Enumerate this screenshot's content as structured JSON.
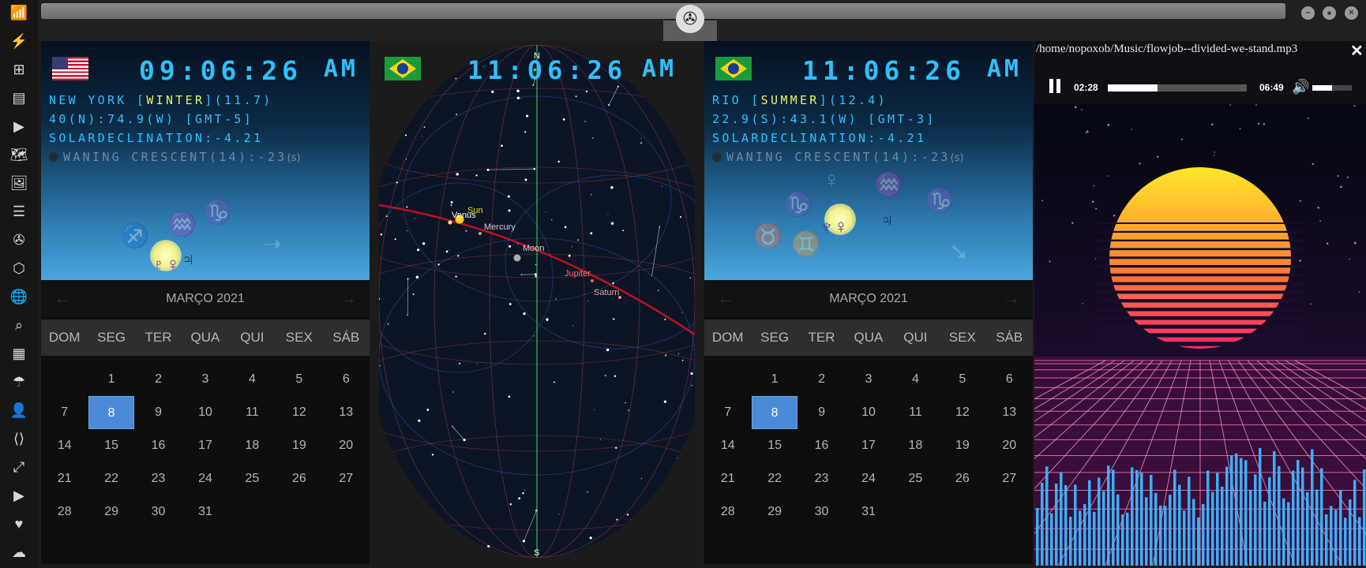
{
  "dock": {
    "icons": [
      "wifi-icon",
      "lightning-icon",
      "windows-icon",
      "inbox-icon",
      "play-icon",
      "map-icon",
      "image-icon",
      "news-icon",
      "rebel-icon",
      "hexagon-icon",
      "globe-icon",
      "search-icon",
      "world-map-icon",
      "umbrella-icon",
      "contacts-icon",
      "code-icon",
      "fullscreen-icon",
      "youtube-icon",
      "heart-icon",
      "cloud-icon"
    ],
    "glyphs": [
      "📶",
      "⚡",
      "⊞",
      "▤",
      "▶",
      "🗺",
      "🖼",
      "☰",
      "✇",
      "⬡",
      "🌐",
      "⌕",
      "▦",
      "☂",
      "👤",
      "⟨⟩",
      "⤢",
      "▶",
      "♥",
      "☁"
    ]
  },
  "window": {
    "minimize": "–",
    "maximize": "■",
    "close": "×",
    "logo": "✇"
  },
  "clocks": [
    {
      "flag": "us",
      "time": "09:06:26",
      "ampm": "AM",
      "city_pre": "NEW YORK [",
      "season": "WINTER",
      "city_post": "](11.7)",
      "coords": "40(N):74.9(W) [GMT-5]",
      "declination": "SOLARDECLINATION:-4.21",
      "moon_main": "WANING CRESCENT(14):-23",
      "moon_suffix": "(s)",
      "jupiter": "♃",
      "planets": "♇♀"
    },
    {
      "flag": "br",
      "time": "11:06:26",
      "ampm": "AM",
      "city_pre": "RIO [",
      "season": "SUMMER",
      "city_post": "](12.4)",
      "coords": "22.9(S):43.1(W) [GMT-3]",
      "declination": "SOLARDECLINATION:-4.21",
      "moon_main": "WANING CRESCENT(14):-23",
      "moon_suffix": "(s)",
      "jupiter": "♃",
      "planets": "♆♀"
    }
  ],
  "sky": {
    "time": "11:06:26",
    "ampm": "AM",
    "north": "N",
    "south": "S",
    "bodies": [
      "Sun",
      "Venus",
      "Mercury",
      "Moon",
      "Jupiter",
      "Saturn"
    ]
  },
  "calendars": [
    {
      "month": "MARÇO 2021",
      "prev": "←",
      "next": "→",
      "weekdays": [
        "DOM",
        "SEG",
        "TER",
        "QUA",
        "QUI",
        "SEX",
        "SÁB"
      ],
      "days": [
        "",
        "1",
        "2",
        "3",
        "4",
        "5",
        "6",
        "7",
        "8",
        "9",
        "10",
        "11",
        "12",
        "13",
        "14",
        "15",
        "16",
        "17",
        "18",
        "19",
        "20",
        "21",
        "22",
        "23",
        "24",
        "25",
        "26",
        "27",
        "28",
        "29",
        "30",
        "31"
      ],
      "selected": "8"
    },
    {
      "month": "MARÇO 2021",
      "prev": "←",
      "next": "→",
      "weekdays": [
        "DOM",
        "SEG",
        "TER",
        "QUA",
        "QUI",
        "SEX",
        "SÁB"
      ],
      "days": [
        "",
        "1",
        "2",
        "3",
        "4",
        "5",
        "6",
        "7",
        "8",
        "9",
        "10",
        "11",
        "12",
        "13",
        "14",
        "15",
        "16",
        "17",
        "18",
        "19",
        "20",
        "21",
        "22",
        "23",
        "24",
        "25",
        "26",
        "27",
        "28",
        "29",
        "30",
        "31"
      ],
      "selected": "8"
    }
  ],
  "player": {
    "path": "/home/nopoxob/Music/flowjob--divided-we-stand.mp3",
    "close": "✕",
    "current": "02:28",
    "total": "06:49",
    "progress": 0.36,
    "volume": 0.5
  }
}
